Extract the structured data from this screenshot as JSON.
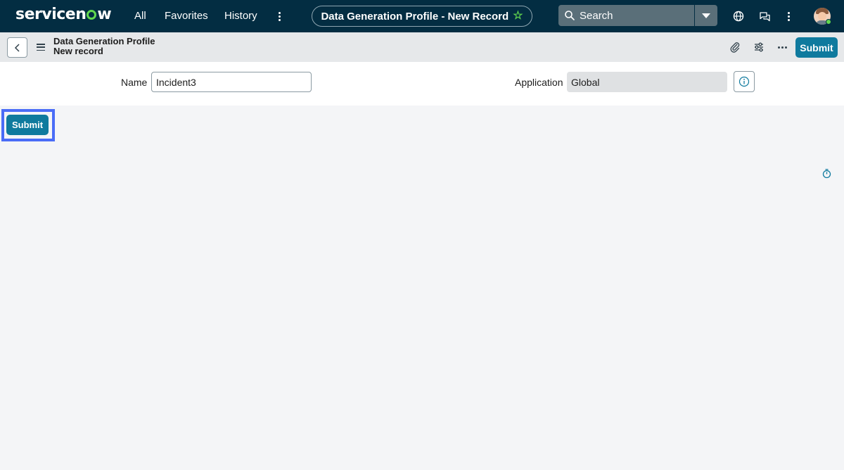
{
  "brand": {
    "logo_text_a": "servicen",
    "logo_text_b": "w",
    "accent_color": "#62d84e",
    "nav_bg": "#032d42"
  },
  "topnav": {
    "links": {
      "all": "All",
      "favorites": "Favorites",
      "history": "History"
    },
    "context_title": "Data Generation Profile - New Record",
    "search_placeholder": "Search"
  },
  "subheader": {
    "title_line1": "Data Generation Profile",
    "title_line2": "New record",
    "submit_label": "Submit"
  },
  "form": {
    "name_label": "Name",
    "name_value": "Incident3",
    "application_label": "Application",
    "application_value": "Global"
  },
  "footer_actions": {
    "submit_label": "Submit"
  },
  "icons": [
    "more-vertical-icon",
    "star-icon",
    "search-icon",
    "chevron-down-icon",
    "globe-icon",
    "chat-icon",
    "back-icon",
    "menu-icon",
    "paperclip-icon",
    "sliders-icon",
    "more-horizontal-icon",
    "info-icon",
    "timer-icon"
  ]
}
